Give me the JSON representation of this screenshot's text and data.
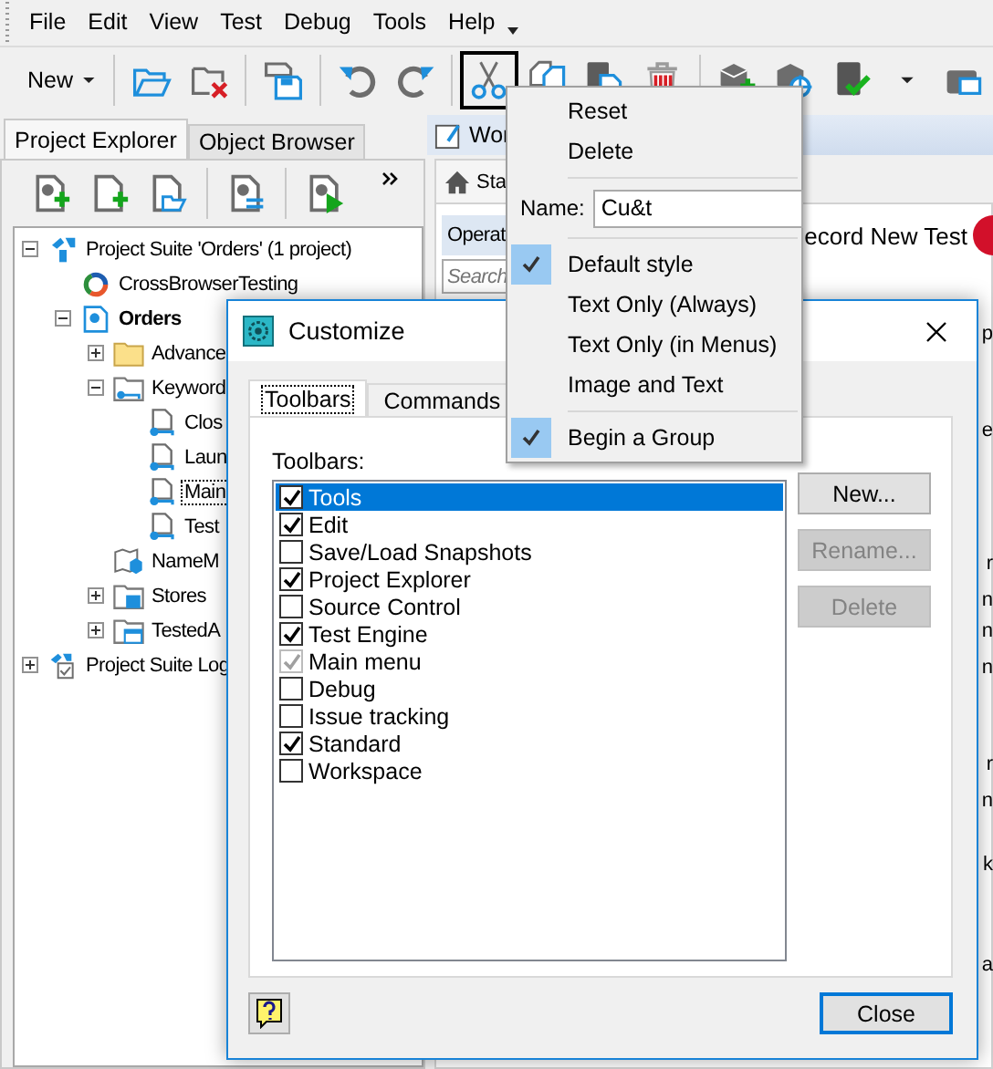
{
  "menu_bar": [
    {
      "label": "File"
    },
    {
      "label": "Edit"
    },
    {
      "label": "View"
    },
    {
      "label": "Test"
    },
    {
      "label": "Debug"
    },
    {
      "label": "Tools"
    },
    {
      "label": "Help"
    }
  ],
  "toolbar": [
    {
      "kind": "new",
      "label": "New",
      "selected": false
    },
    {
      "kind": "separator"
    },
    {
      "kind": "open-folder",
      "selected": false
    },
    {
      "kind": "folder-delete",
      "selected": false
    },
    {
      "kind": "separator"
    },
    {
      "kind": "save",
      "selected": false
    },
    {
      "kind": "separator"
    },
    {
      "kind": "undo",
      "selected": false
    },
    {
      "kind": "redo",
      "selected": false
    },
    {
      "kind": "separator"
    },
    {
      "kind": "scissors",
      "selected": true
    },
    {
      "kind": "copy",
      "selected": false
    },
    {
      "kind": "paste",
      "selected": false
    },
    {
      "kind": "trash",
      "selected": false
    },
    {
      "kind": "separator"
    },
    {
      "kind": "cube-add",
      "selected": false
    },
    {
      "kind": "cube-target",
      "selected": false
    },
    {
      "kind": "document-check",
      "selected": false
    },
    {
      "kind": "caret",
      "selected": false
    },
    {
      "kind": "camera",
      "selected": false
    }
  ],
  "left_panel": {
    "tabs": [
      {
        "label": "Project Explorer",
        "selected": true
      },
      {
        "label": "Object Browser",
        "selected": false
      }
    ],
    "toolbar": [
      {
        "kind": "add-item"
      },
      {
        "kind": "add-file"
      },
      {
        "kind": "open-file"
      },
      {
        "kind": "separator"
      },
      {
        "kind": "properties"
      },
      {
        "kind": "separator"
      },
      {
        "kind": "run"
      }
    ],
    "tree": [
      {
        "label": "Project Suite 'Orders' (1 project)",
        "kind": "suite",
        "expanded": true,
        "selected": false,
        "children": [
          {
            "label": "CrossBrowserTesting",
            "kind": "ring",
            "selected": false
          },
          {
            "label": "Orders",
            "kind": "project",
            "bold": true,
            "expanded": true,
            "selected": false,
            "children": [
              {
                "label": "Advance",
                "kind": "folder",
                "expanded": false,
                "selected": false
              },
              {
                "label": "Keyword",
                "kind": "key-folder",
                "expanded": true,
                "selected": false,
                "children": [
                  {
                    "label": "Clos",
                    "kind": "key-file",
                    "selected": false
                  },
                  {
                    "label": "Laun",
                    "kind": "key-file",
                    "selected": false
                  },
                  {
                    "label": "Main",
                    "kind": "key-file",
                    "selected": true
                  },
                  {
                    "label": "Test",
                    "kind": "key-file",
                    "selected": false
                  }
                ]
              },
              {
                "label": "NameM",
                "kind": "map",
                "selected": false
              },
              {
                "label": "Stores",
                "kind": "store-folder",
                "expanded": false,
                "selected": false
              },
              {
                "label": "TestedA",
                "kind": "app-folder",
                "expanded": false,
                "selected": false
              }
            ]
          }
        ]
      },
      {
        "label": "Project Suite Log",
        "kind": "log",
        "expanded": false,
        "selected": false
      }
    ]
  },
  "workspace": {
    "tab": "Wor",
    "subtab": "Sta",
    "header": "Operat",
    "search": {
      "placeholder": "Search"
    },
    "record": "ecord New Test",
    "fragments": [
      "p",
      "e",
      "r",
      "n",
      "n",
      "n",
      "r",
      "n",
      "k",
      "a"
    ]
  },
  "context_menu": {
    "items": [
      {
        "kind": "action",
        "label": "Reset"
      },
      {
        "kind": "action",
        "label": "Delete"
      },
      {
        "kind": "separator"
      },
      {
        "kind": "name",
        "label": "Name:",
        "value": "Cu&t"
      },
      {
        "kind": "separator"
      },
      {
        "kind": "check",
        "label": "Default style",
        "checked": true
      },
      {
        "kind": "check",
        "label": "Text Only (Always)",
        "checked": false
      },
      {
        "kind": "check",
        "label": "Text Only (in Menus)",
        "checked": false
      },
      {
        "kind": "check",
        "label": "Image and Text",
        "checked": false
      },
      {
        "kind": "separator"
      },
      {
        "kind": "check",
        "label": "Begin a Group",
        "checked": true
      }
    ]
  },
  "dialog": {
    "title": "Customize",
    "tabs": [
      {
        "label": "Toolbars",
        "selected": true
      },
      {
        "label": "Commands",
        "selected": false
      }
    ],
    "list_label": "Toolbars:",
    "toolbars": [
      {
        "label": "Tools",
        "checked": true,
        "selected": true,
        "disabled": false
      },
      {
        "label": "Edit",
        "checked": true,
        "selected": false,
        "disabled": false
      },
      {
        "label": "Save/Load Snapshots",
        "checked": false,
        "selected": false,
        "disabled": false
      },
      {
        "label": "Project Explorer",
        "checked": true,
        "selected": false,
        "disabled": false
      },
      {
        "label": "Source Control",
        "checked": false,
        "selected": false,
        "disabled": false
      },
      {
        "label": "Test Engine",
        "checked": true,
        "selected": false,
        "disabled": false
      },
      {
        "label": "Main menu",
        "checked": true,
        "selected": false,
        "disabled": true
      },
      {
        "label": "Debug",
        "checked": false,
        "selected": false,
        "disabled": false
      },
      {
        "label": "Issue tracking",
        "checked": false,
        "selected": false,
        "disabled": false
      },
      {
        "label": "Standard",
        "checked": true,
        "selected": false,
        "disabled": false
      },
      {
        "label": "Workspace",
        "checked": false,
        "selected": false,
        "disabled": false
      }
    ],
    "buttons": [
      {
        "label": "New...",
        "disabled": false
      },
      {
        "label": "Rename...",
        "disabled": true
      },
      {
        "label": "Delete",
        "disabled": true
      }
    ],
    "close": "Close"
  }
}
